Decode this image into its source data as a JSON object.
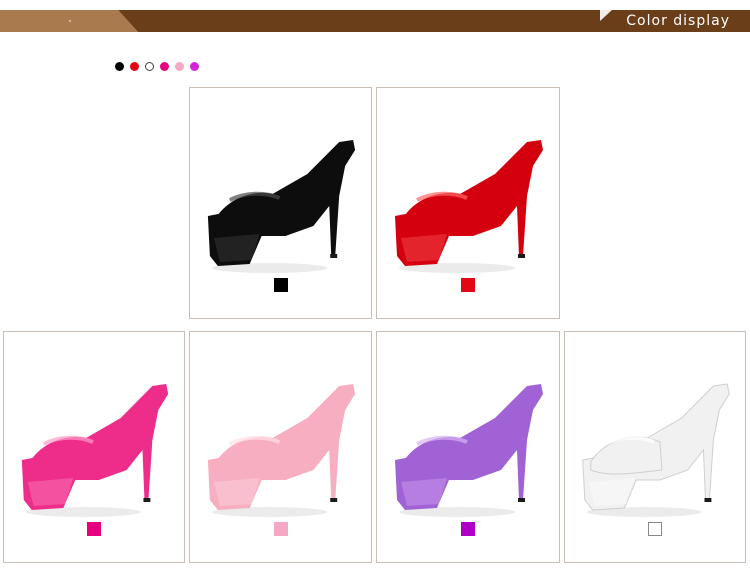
{
  "header": {
    "title": "Color display",
    "bar_color": "#6b3e1a",
    "accent_color": "#a97a4e"
  },
  "color_dots": [
    {
      "name": "black",
      "color": "#000000"
    },
    {
      "name": "red",
      "color": "#e30613"
    },
    {
      "name": "white",
      "color": "#ffffff"
    },
    {
      "name": "rose",
      "color": "#e6007e"
    },
    {
      "name": "pink",
      "color": "#f4a8c4"
    },
    {
      "name": "purple",
      "color": "#d426d4"
    }
  ],
  "products": [
    {
      "name": "black",
      "shoe_color": "#0d0d0d",
      "highlight": "#4a4a4a",
      "swatch": "#000000"
    },
    {
      "name": "red",
      "shoe_color": "#d4000e",
      "highlight": "#ff6666",
      "swatch": "#e30613"
    },
    {
      "name": "rose",
      "shoe_color": "#ee2c8a",
      "highlight": "#ff9ccb",
      "swatch": "#e6007e"
    },
    {
      "name": "pink",
      "shoe_color": "#f6aec0",
      "highlight": "#ffe0e8",
      "swatch": "#f4a8c4"
    },
    {
      "name": "purple",
      "shoe_color": "#a162d6",
      "highlight": "#d9b4f4",
      "swatch": "#b000c8"
    },
    {
      "name": "white",
      "shoe_color": "#f1f1f1",
      "highlight": "#ffffff",
      "swatch": "#ffffff"
    }
  ]
}
